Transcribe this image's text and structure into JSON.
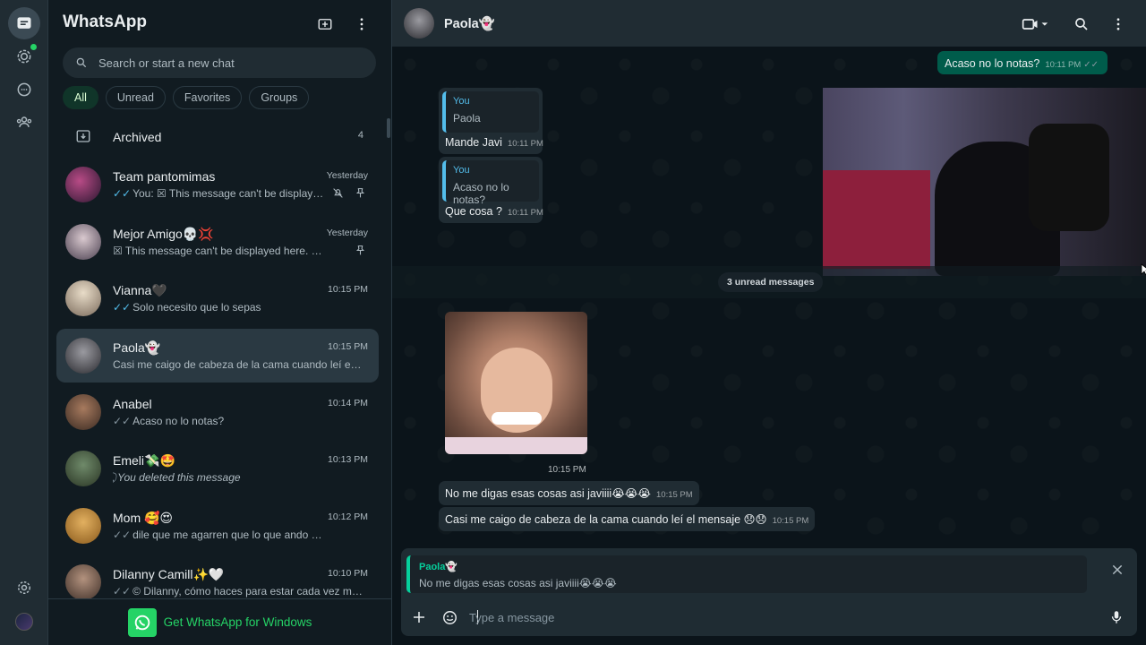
{
  "app": {
    "title": "WhatsApp"
  },
  "colors": {
    "accent": "#25d366",
    "panel": "#111b21",
    "header": "#202c33",
    "bubble_out": "#005c4b",
    "bubble_in": "#202c33",
    "tick_read": "#53bdeb"
  },
  "rail": {
    "icons": [
      "chats-icon",
      "status-icon",
      "channels-icon",
      "communities-icon",
      "settings-icon",
      "profile-avatar"
    ]
  },
  "search": {
    "placeholder": "Search or start a new chat"
  },
  "filters": [
    "All",
    "Unread",
    "Favorites",
    "Groups"
  ],
  "archived": {
    "label": "Archived",
    "count": "4"
  },
  "chats": [
    {
      "name": "Team pantomimas",
      "time": "Yesterday",
      "preview": "You: ☒ This message can't be displayed ...",
      "tick": "read",
      "muted": true,
      "pinned": true
    },
    {
      "name": "Mejor Amigo💀💢",
      "time": "Yesterday",
      "preview": "☒ This message can't be displayed here. Please...",
      "tick": "",
      "pinned": true
    },
    {
      "name": "Vianna🖤",
      "time": "10:15 PM",
      "preview": "Solo necesito que lo sepas",
      "tick": "read"
    },
    {
      "name": "Paola👻",
      "time": "10:15 PM",
      "preview": "Casi me caigo de cabeza de la cama cuando leí el m...",
      "tick": "",
      "selected": true
    },
    {
      "name": "Anabel",
      "time": "10:14 PM",
      "preview": "Acaso no lo notas?",
      "tick": "delivered"
    },
    {
      "name": "Emeli💸🤩",
      "time": "10:13 PM",
      "preview": "You deleted this message",
      "tick": "deleted"
    },
    {
      "name": "Mom 🥰😍",
      "time": "10:12 PM",
      "preview": "dile que me agarren que lo que ando e chuky",
      "tick": "delivered"
    },
    {
      "name": "Dilanny Camill✨🤍",
      "time": "10:10 PM",
      "preview": "© Dilanny, cómo haces para estar cada vez más l...",
      "tick": "delivered"
    }
  ],
  "get_windows": {
    "label": "Get WhatsApp for Windows"
  },
  "conversation": {
    "contact_name": "Paola👻",
    "messages": {
      "out_1": {
        "text": "Acaso no lo notas?",
        "time": "10:11 PM"
      },
      "in_1": {
        "quote_author": "You",
        "quote_text": "Paola",
        "text": "Mande Javi",
        "time": "10:11 PM"
      },
      "in_2": {
        "quote_author": "You",
        "quote_text": "Acaso no lo notas?",
        "text": "Que cosa ?",
        "time": "10:11 PM"
      },
      "unread_label": "3 unread messages",
      "image_time": "10:15 PM",
      "in_3": {
        "text": "No me digas esas cosas asi javiiii😭😭😭",
        "time": "10:15 PM"
      },
      "in_4": {
        "text": "Casi me caigo de cabeza de la cama cuando leí el mensaje 😞😞",
        "time": "10:15 PM"
      }
    },
    "reply": {
      "author": "Paola👻",
      "text": "No me digas esas cosas asi javiiii😭😭😭"
    },
    "composer": {
      "placeholder": "Type a message"
    }
  }
}
